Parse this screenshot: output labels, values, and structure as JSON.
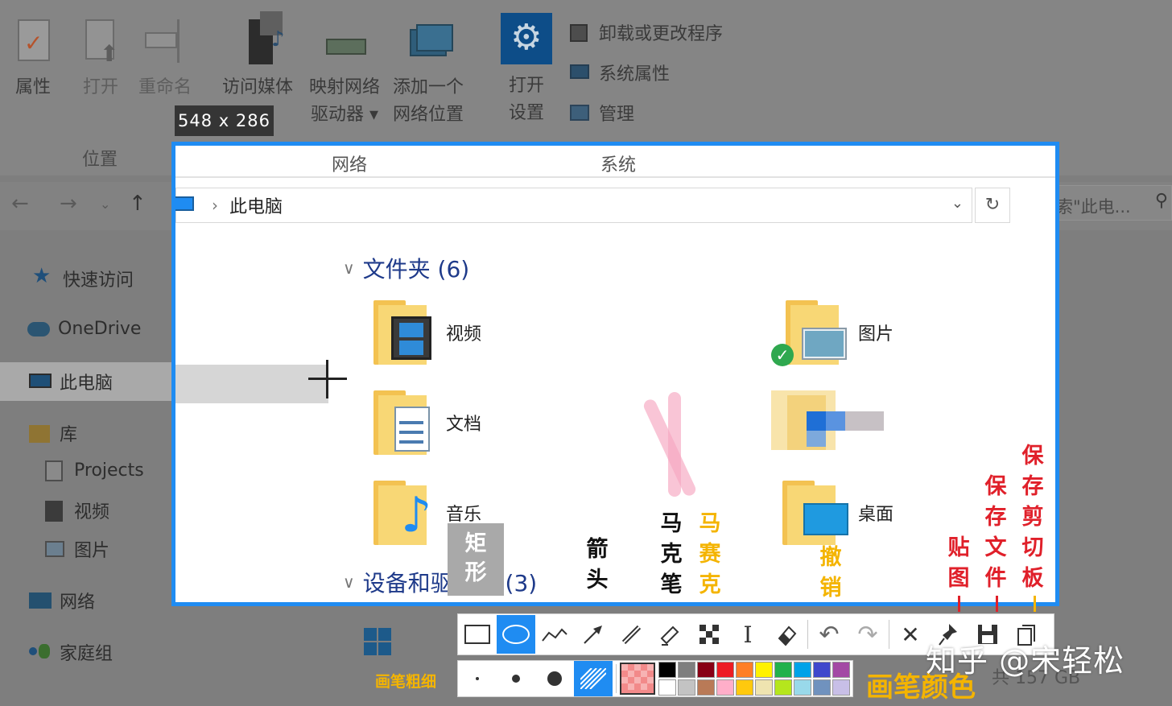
{
  "ribbon": {
    "properties": "属性",
    "open": "打开",
    "rename": "重命名",
    "access_media": "访问媒体",
    "map_drive_line1": "映射网络",
    "map_drive_line2": "驱动器 ▾",
    "add_location_line1": "添加一个",
    "add_location_line2": "网络位置",
    "open_settings_line1": "打开",
    "open_settings_line2": "设置",
    "uninstall": "卸载或更改程序",
    "system_properties": "系统属性",
    "manage": "管理",
    "group_location": "位置",
    "group_network": "网络",
    "group_system": "系统"
  },
  "size_tooltip": "548 x 286",
  "address": {
    "crumb": "此电脑",
    "search_placeholder": "搜索\"此电..."
  },
  "sidebar": {
    "items": [
      {
        "label": "快速访问",
        "icon": "star-icon"
      },
      {
        "label": "OneDrive",
        "icon": "cloud-icon"
      },
      {
        "label": "此电脑",
        "icon": "computer-icon"
      },
      {
        "label": "库",
        "icon": "library-icon"
      },
      {
        "label": "Projects",
        "icon": "project-icon"
      },
      {
        "label": "视频",
        "icon": "video-icon"
      },
      {
        "label": "图片",
        "icon": "picture-icon"
      },
      {
        "label": "网络",
        "icon": "network-icon"
      },
      {
        "label": "家庭组",
        "icon": "homegroup-icon"
      }
    ]
  },
  "main": {
    "folders_title": "文件夹 (6)",
    "devices_title": "设备和驱动器 (3)",
    "folders": [
      {
        "label": "视频"
      },
      {
        "label": "图片"
      },
      {
        "label": "文档"
      },
      {
        "label": "音乐"
      },
      {
        "label": "桌面"
      }
    ],
    "below_text": "共 157 GB"
  },
  "annotations": {
    "rect": "矩形",
    "arrow": "箭头",
    "marker": "马克笔",
    "mosaic": "马赛克",
    "undo": "撤销",
    "pin": "贴图",
    "save_file": "保存文件",
    "save_clipboard": "保存剪切板",
    "pen_size": "画笔粗细",
    "pen_color": "画笔颜色"
  },
  "watermark": "知乎 @宋轻松",
  "colors": {
    "accent": "#1f8cf2",
    "palette_row1": [
      "#000000",
      "#7f7f7f",
      "#880015",
      "#ed1c24",
      "#ff7f27",
      "#fff200",
      "#22b14c",
      "#00a2e8",
      "#3f48cc",
      "#a349a4"
    ],
    "palette_row2": [
      "#ffffff",
      "#c3c3c3",
      "#b97a57",
      "#ffaec9",
      "#ffc90e",
      "#efe4b0",
      "#b5e61d",
      "#99d9ea",
      "#7092be",
      "#c8bfe7"
    ]
  }
}
